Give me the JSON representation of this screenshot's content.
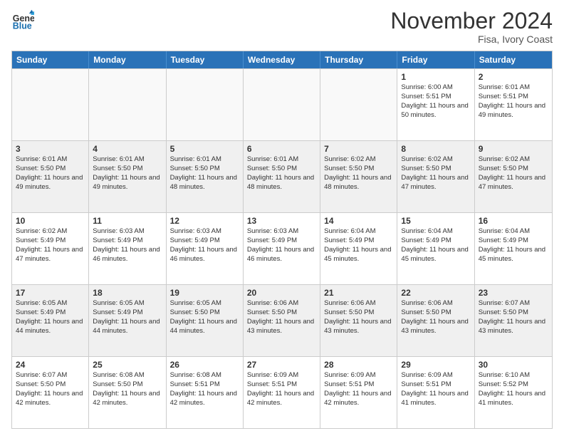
{
  "header": {
    "logo_general": "General",
    "logo_blue": "Blue",
    "month_title": "November 2024",
    "location": "Fisa, Ivory Coast"
  },
  "weekdays": [
    "Sunday",
    "Monday",
    "Tuesday",
    "Wednesday",
    "Thursday",
    "Friday",
    "Saturday"
  ],
  "rows": [
    [
      {
        "day": "",
        "empty": true
      },
      {
        "day": "",
        "empty": true
      },
      {
        "day": "",
        "empty": true
      },
      {
        "day": "",
        "empty": true
      },
      {
        "day": "",
        "empty": true
      },
      {
        "day": "1",
        "sunrise": "Sunrise: 6:00 AM",
        "sunset": "Sunset: 5:51 PM",
        "daylight": "Daylight: 11 hours and 50 minutes."
      },
      {
        "day": "2",
        "sunrise": "Sunrise: 6:01 AM",
        "sunset": "Sunset: 5:51 PM",
        "daylight": "Daylight: 11 hours and 49 minutes."
      }
    ],
    [
      {
        "day": "3",
        "sunrise": "Sunrise: 6:01 AM",
        "sunset": "Sunset: 5:50 PM",
        "daylight": "Daylight: 11 hours and 49 minutes."
      },
      {
        "day": "4",
        "sunrise": "Sunrise: 6:01 AM",
        "sunset": "Sunset: 5:50 PM",
        "daylight": "Daylight: 11 hours and 49 minutes."
      },
      {
        "day": "5",
        "sunrise": "Sunrise: 6:01 AM",
        "sunset": "Sunset: 5:50 PM",
        "daylight": "Daylight: 11 hours and 48 minutes."
      },
      {
        "day": "6",
        "sunrise": "Sunrise: 6:01 AM",
        "sunset": "Sunset: 5:50 PM",
        "daylight": "Daylight: 11 hours and 48 minutes."
      },
      {
        "day": "7",
        "sunrise": "Sunrise: 6:02 AM",
        "sunset": "Sunset: 5:50 PM",
        "daylight": "Daylight: 11 hours and 48 minutes."
      },
      {
        "day": "8",
        "sunrise": "Sunrise: 6:02 AM",
        "sunset": "Sunset: 5:50 PM",
        "daylight": "Daylight: 11 hours and 47 minutes."
      },
      {
        "day": "9",
        "sunrise": "Sunrise: 6:02 AM",
        "sunset": "Sunset: 5:50 PM",
        "daylight": "Daylight: 11 hours and 47 minutes."
      }
    ],
    [
      {
        "day": "10",
        "sunrise": "Sunrise: 6:02 AM",
        "sunset": "Sunset: 5:49 PM",
        "daylight": "Daylight: 11 hours and 47 minutes."
      },
      {
        "day": "11",
        "sunrise": "Sunrise: 6:03 AM",
        "sunset": "Sunset: 5:49 PM",
        "daylight": "Daylight: 11 hours and 46 minutes."
      },
      {
        "day": "12",
        "sunrise": "Sunrise: 6:03 AM",
        "sunset": "Sunset: 5:49 PM",
        "daylight": "Daylight: 11 hours and 46 minutes."
      },
      {
        "day": "13",
        "sunrise": "Sunrise: 6:03 AM",
        "sunset": "Sunset: 5:49 PM",
        "daylight": "Daylight: 11 hours and 46 minutes."
      },
      {
        "day": "14",
        "sunrise": "Sunrise: 6:04 AM",
        "sunset": "Sunset: 5:49 PM",
        "daylight": "Daylight: 11 hours and 45 minutes."
      },
      {
        "day": "15",
        "sunrise": "Sunrise: 6:04 AM",
        "sunset": "Sunset: 5:49 PM",
        "daylight": "Daylight: 11 hours and 45 minutes."
      },
      {
        "day": "16",
        "sunrise": "Sunrise: 6:04 AM",
        "sunset": "Sunset: 5:49 PM",
        "daylight": "Daylight: 11 hours and 45 minutes."
      }
    ],
    [
      {
        "day": "17",
        "sunrise": "Sunrise: 6:05 AM",
        "sunset": "Sunset: 5:49 PM",
        "daylight": "Daylight: 11 hours and 44 minutes."
      },
      {
        "day": "18",
        "sunrise": "Sunrise: 6:05 AM",
        "sunset": "Sunset: 5:49 PM",
        "daylight": "Daylight: 11 hours and 44 minutes."
      },
      {
        "day": "19",
        "sunrise": "Sunrise: 6:05 AM",
        "sunset": "Sunset: 5:50 PM",
        "daylight": "Daylight: 11 hours and 44 minutes."
      },
      {
        "day": "20",
        "sunrise": "Sunrise: 6:06 AM",
        "sunset": "Sunset: 5:50 PM",
        "daylight": "Daylight: 11 hours and 43 minutes."
      },
      {
        "day": "21",
        "sunrise": "Sunrise: 6:06 AM",
        "sunset": "Sunset: 5:50 PM",
        "daylight": "Daylight: 11 hours and 43 minutes."
      },
      {
        "day": "22",
        "sunrise": "Sunrise: 6:06 AM",
        "sunset": "Sunset: 5:50 PM",
        "daylight": "Daylight: 11 hours and 43 minutes."
      },
      {
        "day": "23",
        "sunrise": "Sunrise: 6:07 AM",
        "sunset": "Sunset: 5:50 PM",
        "daylight": "Daylight: 11 hours and 43 minutes."
      }
    ],
    [
      {
        "day": "24",
        "sunrise": "Sunrise: 6:07 AM",
        "sunset": "Sunset: 5:50 PM",
        "daylight": "Daylight: 11 hours and 42 minutes."
      },
      {
        "day": "25",
        "sunrise": "Sunrise: 6:08 AM",
        "sunset": "Sunset: 5:50 PM",
        "daylight": "Daylight: 11 hours and 42 minutes."
      },
      {
        "day": "26",
        "sunrise": "Sunrise: 6:08 AM",
        "sunset": "Sunset: 5:51 PM",
        "daylight": "Daylight: 11 hours and 42 minutes."
      },
      {
        "day": "27",
        "sunrise": "Sunrise: 6:09 AM",
        "sunset": "Sunset: 5:51 PM",
        "daylight": "Daylight: 11 hours and 42 minutes."
      },
      {
        "day": "28",
        "sunrise": "Sunrise: 6:09 AM",
        "sunset": "Sunset: 5:51 PM",
        "daylight": "Daylight: 11 hours and 42 minutes."
      },
      {
        "day": "29",
        "sunrise": "Sunrise: 6:09 AM",
        "sunset": "Sunset: 5:51 PM",
        "daylight": "Daylight: 11 hours and 41 minutes."
      },
      {
        "day": "30",
        "sunrise": "Sunrise: 6:10 AM",
        "sunset": "Sunset: 5:52 PM",
        "daylight": "Daylight: 11 hours and 41 minutes."
      }
    ]
  ]
}
